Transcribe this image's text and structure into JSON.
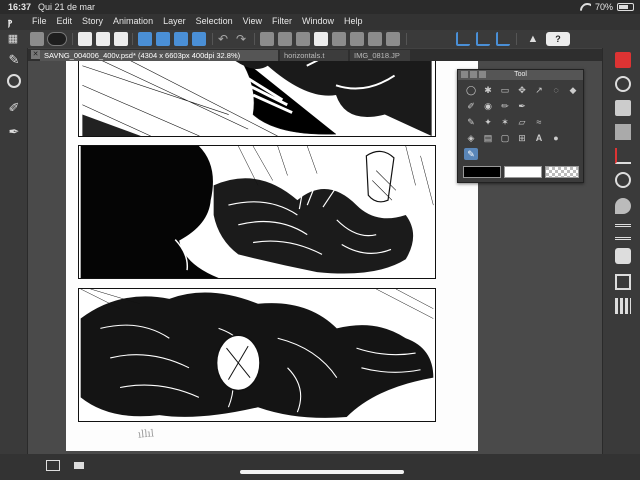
{
  "status": {
    "time": "16:37",
    "date": "Qui 21 de mar",
    "battery": "70%",
    "battery_level": 0.7
  },
  "menubar": {
    "items": [
      "File",
      "Edit",
      "Story",
      "Animation",
      "Layer",
      "Selection",
      "View",
      "Filter",
      "Window",
      "Help"
    ]
  },
  "tabs": [
    {
      "label": "SAVNG_004006_400v.psd* (4304 x 6603px 400dpi 32.8%)",
      "active": true
    },
    {
      "label": "horizontals.t",
      "active": false
    },
    {
      "label": "IMG_0818.JP",
      "active": false
    }
  ],
  "tool_palette": {
    "title": "Tool",
    "main_color": "#000000",
    "sub_color": "#ffffff"
  },
  "page_marks": {
    "signature": "ıllıl"
  },
  "colors": {
    "accent": "#4a8fd6",
    "selected_tool": "#5a86b8",
    "ui_background": "#424242"
  }
}
